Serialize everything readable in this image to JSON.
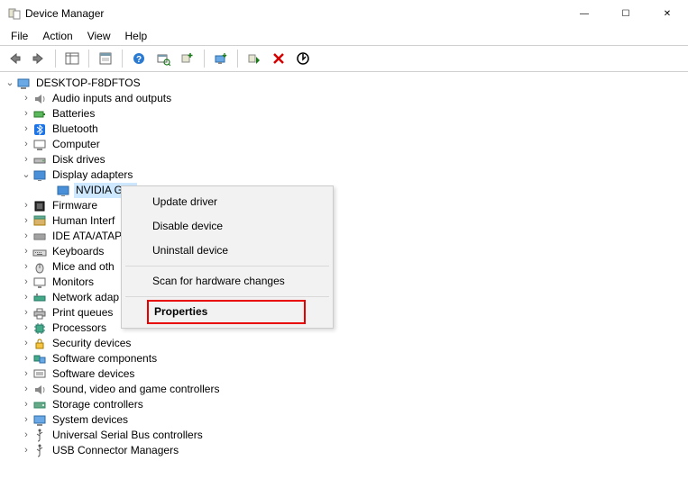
{
  "title": "Device Manager",
  "window_controls": {
    "min": "—",
    "max": "☐",
    "close": "✕"
  },
  "menubar": {
    "file": "File",
    "action": "Action",
    "view": "View",
    "help": "Help"
  },
  "tree": {
    "root": "DESKTOP-F8DFTOS",
    "nodes": {
      "audio": "Audio inputs and outputs",
      "batteries": "Batteries",
      "bluetooth": "Bluetooth",
      "computer": "Computer",
      "diskdrives": "Disk drives",
      "displayadapters": "Display adapters",
      "nvidia": "NVIDIA GeF",
      "firmware": "Firmware",
      "hid": "Human Interf",
      "ide": "IDE ATA/ATAP",
      "keyboards": "Keyboards",
      "mice": "Mice and oth",
      "monitors": "Monitors",
      "network": "Network adap",
      "printq": "Print queues",
      "processors": "Processors",
      "security": "Security devices",
      "swcomp": "Software components",
      "swdev": "Software devices",
      "sound": "Sound, video and game controllers",
      "storage": "Storage controllers",
      "sysdev": "System devices",
      "usbctrl": "Universal Serial Bus controllers",
      "usbconn": "USB Connector Managers"
    }
  },
  "context_menu": {
    "update": "Update driver",
    "disable": "Disable device",
    "uninstall": "Uninstall device",
    "scan": "Scan for hardware changes",
    "properties": "Properties"
  }
}
